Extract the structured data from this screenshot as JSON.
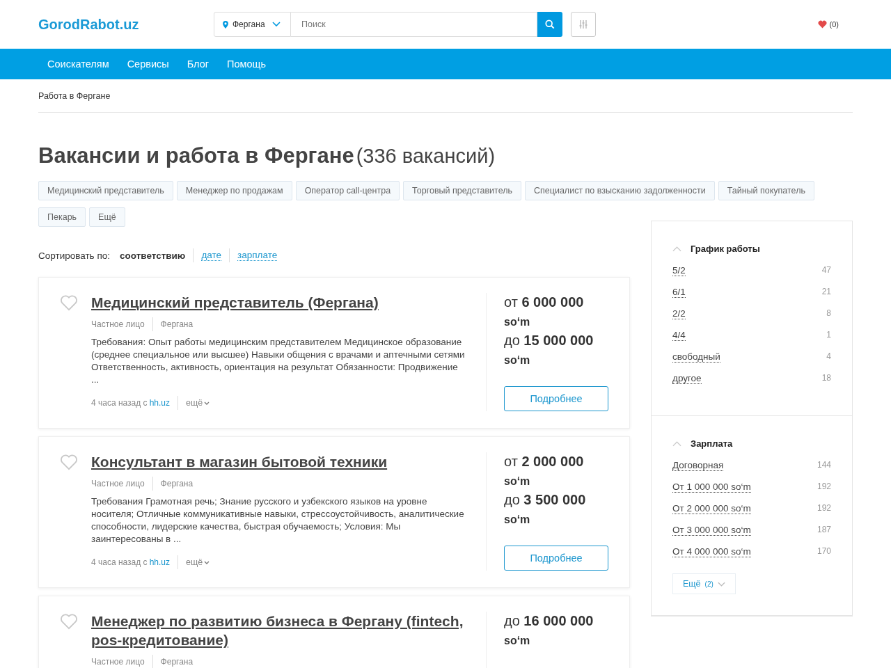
{
  "header": {
    "logo": "GorodRabot.uz",
    "city": "Фергана",
    "search": {
      "placeholder": "Поиск"
    },
    "favorites": "(0)"
  },
  "nav": [
    "Соискателям",
    "Сервисы",
    "Блог",
    "Помощь"
  ],
  "breadcrumb": "Работа в Фергане",
  "title": {
    "main": "Вакансии и работа в Фергане",
    "count": "(336 вакансий)"
  },
  "tags": [
    "Медицинский представитель",
    "Менеджер по продажам",
    "Оператор call-центра",
    "Торговый представитель",
    "Специалист по взысканию задолженности",
    "Тайный покупатель",
    "Пекарь",
    "Ещё"
  ],
  "sort": {
    "label": "Сортировать по:",
    "options": [
      {
        "label": "соответствию",
        "selected": true
      },
      {
        "label": "дате",
        "selected": false
      },
      {
        "label": "зарплате",
        "selected": false
      }
    ]
  },
  "vacancies": [
    {
      "title": "Медицинский представитель (Фергана)",
      "employer": "Частное лицо",
      "city": "Фергана",
      "description": "Требования: Опыт работы медицинским представителем Медицинское образование (среднее специальное или высшее) Навыки общения с врачами и аптечными сетями Ответственность, активность, ориентация на результат Обязанности: Продвижение ...",
      "time": "4 часа назад с",
      "source": "hh.uz",
      "more": "ещё",
      "salary": [
        {
          "prefix": "от",
          "amount": "6 000 000",
          "currency": "so‘m"
        },
        {
          "prefix": "до",
          "amount": "15 000 000",
          "currency": "so‘m"
        }
      ],
      "button": "Подробнее"
    },
    {
      "title": "Консультант в магазин бытовой техники",
      "employer": "Частное лицо",
      "city": "Фергана",
      "description": "Требования Грамотная речь; Знание русского и узбекского языков на уровне носителя; Отличные коммуникативные навыки, стрессоустойчивость, аналитические способности, лидерские качества, быстрая обучаемость; Условия: Мы заинтересованы в ...",
      "time": "4 часа назад с",
      "source": "hh.uz",
      "more": "ещё",
      "salary": [
        {
          "prefix": "от",
          "amount": "2 000 000",
          "currency": "so‘m"
        },
        {
          "prefix": "до",
          "amount": "3 500 000",
          "currency": "so‘m"
        }
      ],
      "button": "Подробнее"
    },
    {
      "title": "Менеджер по развитию бизнеса в Фергану (fintech, pos-кредитование)",
      "employer": "Частное лицо",
      "city": "Фергана",
      "salary": [
        {
          "prefix": "до",
          "amount": "16 000 000",
          "currency": "so‘m"
        }
      ]
    }
  ],
  "filters": [
    {
      "title": "График работы",
      "expanded": true,
      "items": [
        {
          "label": "5/2",
          "count": "47"
        },
        {
          "label": "6/1",
          "count": "21"
        },
        {
          "label": "2/2",
          "count": "8"
        },
        {
          "label": "4/4",
          "count": "1"
        },
        {
          "label": "свободный",
          "count": "4"
        },
        {
          "label": "другое",
          "count": "18"
        }
      ]
    },
    {
      "title": "Зарплата",
      "expanded": true,
      "items": [
        {
          "label": "Договорная",
          "count": "144"
        },
        {
          "label": "От 1 000 000 so‘m",
          "count": "192"
        },
        {
          "label": "От 2 000 000 so‘m",
          "count": "192"
        },
        {
          "label": "От 3 000 000 so‘m",
          "count": "187"
        },
        {
          "label": "От 4 000 000 so‘m",
          "count": "170"
        }
      ],
      "more": {
        "label": "Ещё",
        "count": "(2)"
      }
    }
  ]
}
